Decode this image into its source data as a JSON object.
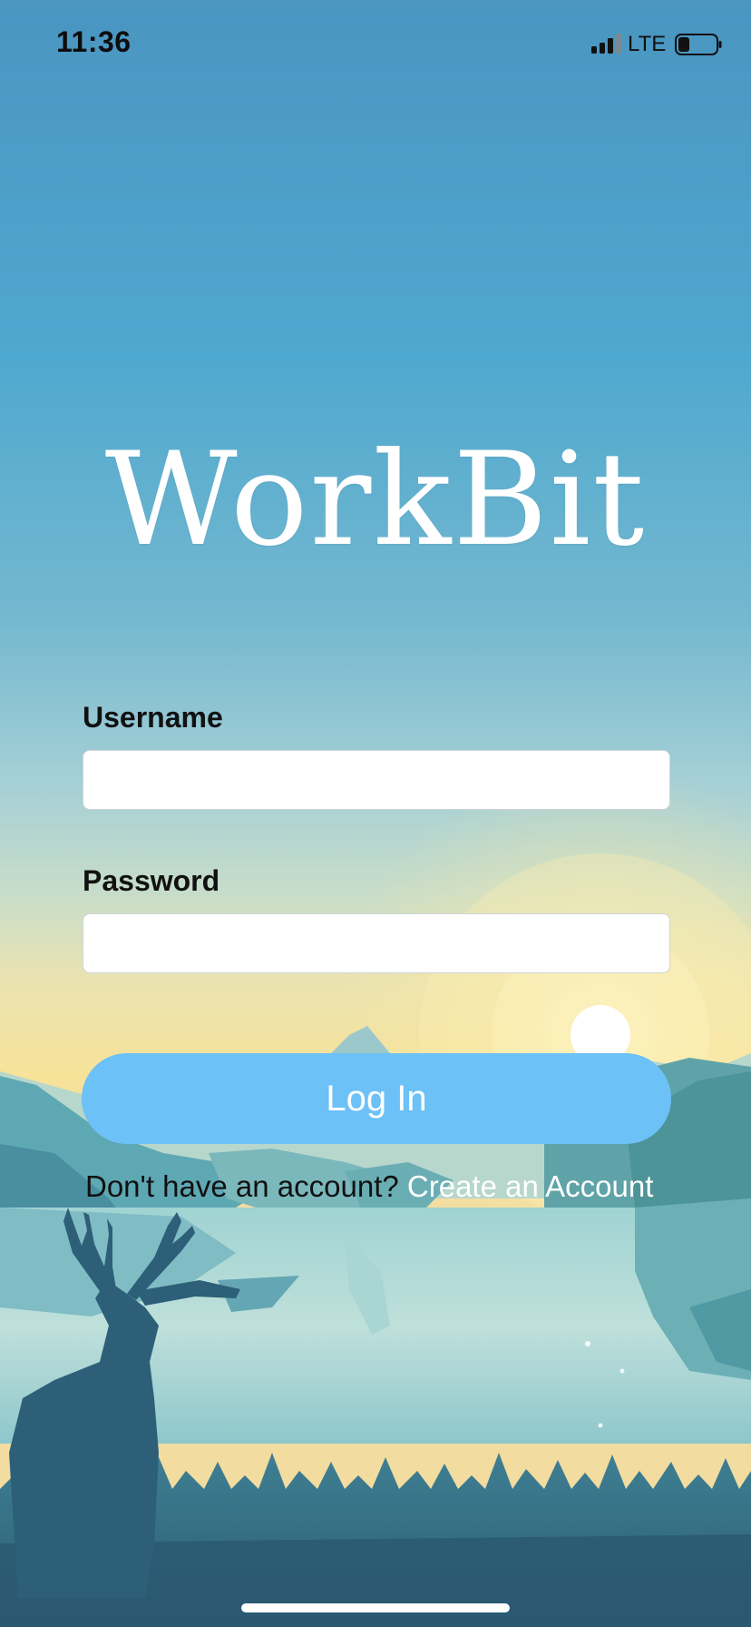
{
  "status_bar": {
    "time": "11:36",
    "network": "LTE",
    "signal_bars_filled": 3,
    "signal_bars_total": 4,
    "battery_level": 0.3
  },
  "app": {
    "title": "WorkBit"
  },
  "form": {
    "username_label": "Username",
    "username_value": "",
    "password_label": "Password",
    "password_value": "",
    "login_label": "Log In"
  },
  "signup": {
    "prompt": "Don't have an account?",
    "link": "Create an Account"
  },
  "colors": {
    "sky_top": "#4a9bc4",
    "sky_mid": "#a7d3d8",
    "horizon": "#f6e9a8",
    "button": "#6cc1f7",
    "text_dark": "#111111",
    "text_light": "#ffffff"
  },
  "icons": [
    "cellular-signal-icon",
    "battery-icon",
    "deer-silhouette"
  ]
}
